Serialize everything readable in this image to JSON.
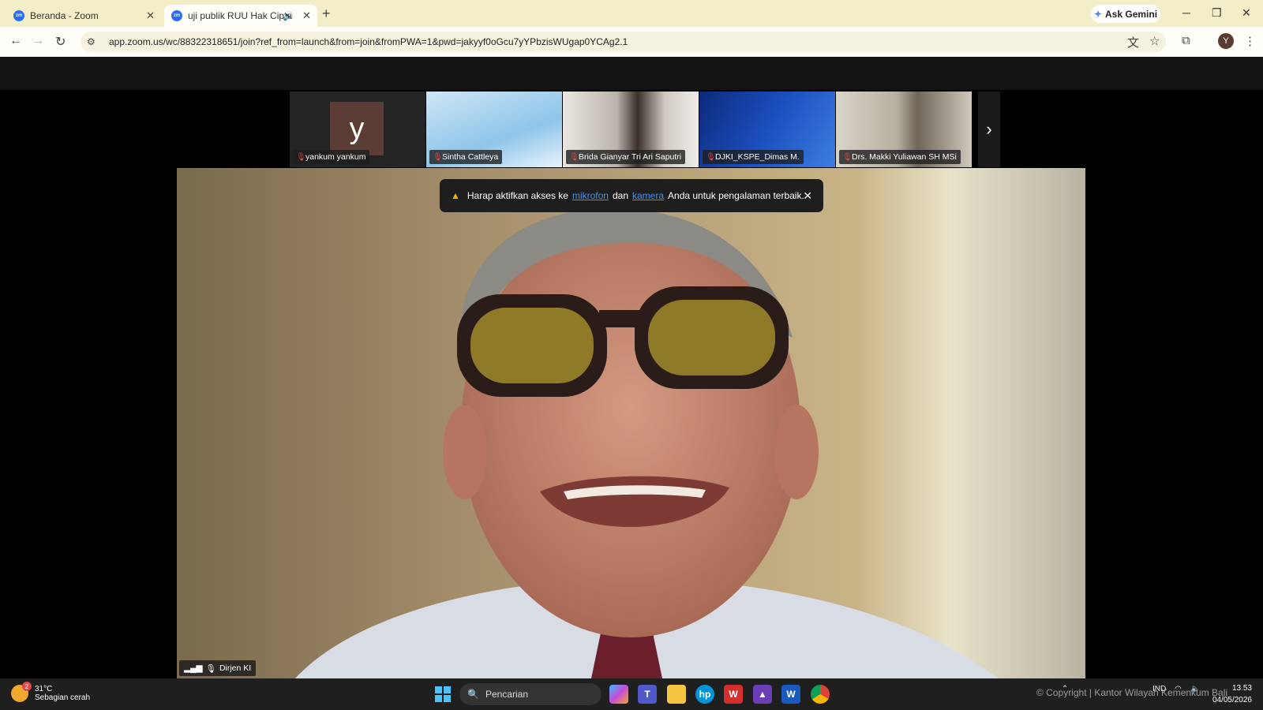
{
  "browser": {
    "tabs": [
      {
        "title": "Beranda - Zoom",
        "favicon": "zm"
      },
      {
        "title": "uji publik RUU Hak Cipta",
        "favicon": "zm"
      }
    ],
    "ask_gemini": "Ask Gemini",
    "url": "app.zoom.us/wc/88322318651/join?ref_from=launch&from=join&fromPWA=1&pwd=jakyyf0oGcu7yYPbzisWUgap0YCAg2.1",
    "profile_initial": "Y"
  },
  "gallery": {
    "tiles": [
      {
        "name": "yankum yankum",
        "avatar_letter": "y"
      },
      {
        "name": "Sintha Cattleya"
      },
      {
        "name": "Brida Gianyar Tri Ari Saputri"
      },
      {
        "name": "DJKI_KSPE_Dimas M."
      },
      {
        "name": "Drs. Makki Yuliawan SH MSi"
      }
    ]
  },
  "notice": {
    "prefix": "Harap aktifkan akses ke",
    "mic_link": "mikrofon",
    "middle": "dan",
    "cam_link": "kamera",
    "suffix": "Anda untuk pengalaman terbaik."
  },
  "speaker": {
    "name": "Dirjen KI"
  },
  "taskbar": {
    "temperature": "31°C",
    "weather_text": "Sebagian cerah",
    "weather_badge": "2",
    "search_placeholder": "Pencarian",
    "language": "IND",
    "time": "13.53",
    "date": "04/05/2026",
    "watermark": "© Copyright | Kantor Wilayah Kemenkum Bali"
  }
}
